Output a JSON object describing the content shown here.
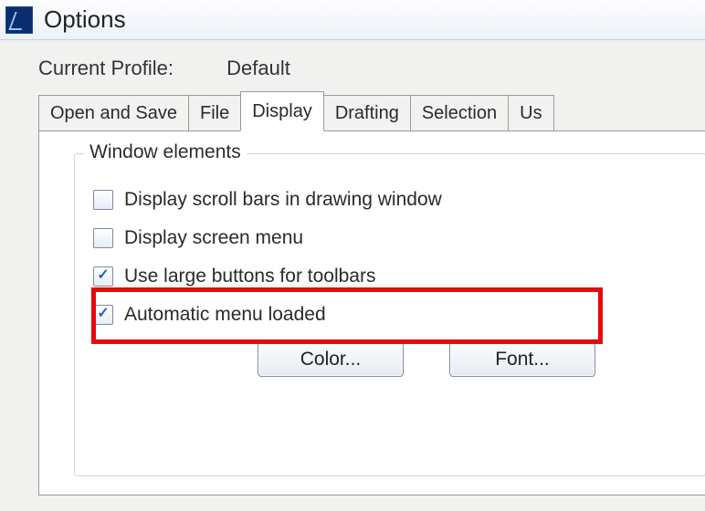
{
  "window": {
    "title": "Options"
  },
  "profile": {
    "label": "Current Profile:",
    "value": "Default"
  },
  "tabs": {
    "open_and_save": "Open and Save",
    "file": "File",
    "display": "Display",
    "drafting": "Drafting",
    "selection": "Selection",
    "user": "Us"
  },
  "display_panel": {
    "group_legend": "Window elements",
    "scroll_bars": {
      "label": "Display scroll bars in drawing window",
      "checked": false
    },
    "screen_menu": {
      "label": "Display screen menu",
      "checked": false
    },
    "large_buttons": {
      "label": "Use large buttons for toolbars",
      "checked": true
    },
    "auto_menu": {
      "label": "Automatic menu loaded",
      "checked": true
    },
    "color_btn": "Color...",
    "font_btn": "Font..."
  }
}
